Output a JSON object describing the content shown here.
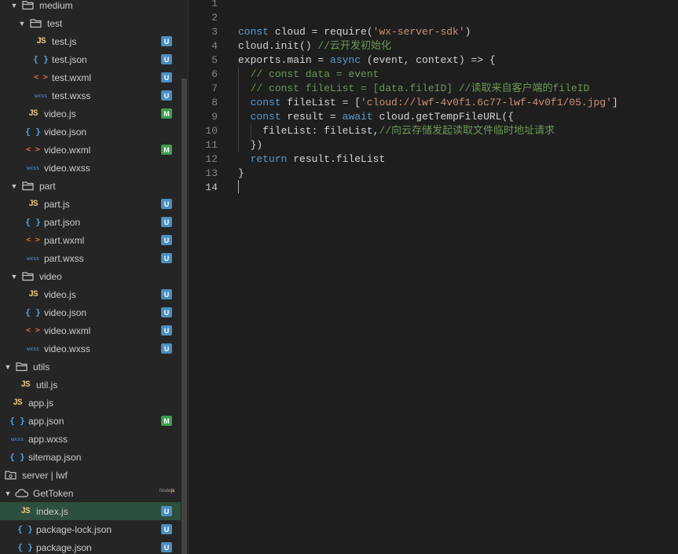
{
  "explorer": {
    "rows": [
      {
        "label": "medium",
        "type": "folder",
        "badge": "",
        "depth": 1
      },
      {
        "label": "test",
        "type": "folder",
        "badge": "",
        "depth": 2
      },
      {
        "label": "test.js",
        "type": "js",
        "badge": "U",
        "depth": 4
      },
      {
        "label": "test.json",
        "type": "json",
        "badge": "U",
        "depth": 4
      },
      {
        "label": "test.wxml",
        "type": "wxml",
        "badge": "U",
        "depth": 4
      },
      {
        "label": "test.wxss",
        "type": "wxss",
        "badge": "U",
        "depth": 4
      },
      {
        "label": "video.js",
        "type": "js",
        "badge": "M",
        "depth": 3
      },
      {
        "label": "video.json",
        "type": "json",
        "badge": "",
        "depth": 3
      },
      {
        "label": "video.wxml",
        "type": "wxml",
        "badge": "M",
        "depth": 3
      },
      {
        "label": "video.wxss",
        "type": "wxss",
        "badge": "",
        "depth": 3
      },
      {
        "label": "part",
        "type": "folder",
        "badge": "",
        "depth": 1
      },
      {
        "label": "part.js",
        "type": "js",
        "badge": "U",
        "depth": 3
      },
      {
        "label": "part.json",
        "type": "json",
        "badge": "U",
        "depth": 3
      },
      {
        "label": "part.wxml",
        "type": "wxml",
        "badge": "U",
        "depth": 3
      },
      {
        "label": "part.wxss",
        "type": "wxss",
        "badge": "U",
        "depth": 3
      },
      {
        "label": "video",
        "type": "folder",
        "badge": "",
        "depth": 1
      },
      {
        "label": "video.js",
        "type": "js",
        "badge": "U",
        "depth": 3
      },
      {
        "label": "video.json",
        "type": "json",
        "badge": "U",
        "depth": 3
      },
      {
        "label": "video.wxml",
        "type": "wxml",
        "badge": "U",
        "depth": 3
      },
      {
        "label": "video.wxss",
        "type": "wxss",
        "badge": "U",
        "depth": 3
      },
      {
        "label": "utils",
        "type": "folder",
        "badge": "",
        "depth": 0
      },
      {
        "label": "util.js",
        "type": "js",
        "badge": "",
        "depth": 2
      },
      {
        "label": "app.js",
        "type": "js",
        "badge": "",
        "depth": 1
      },
      {
        "label": "app.json",
        "type": "json",
        "badge": "M",
        "depth": 1
      },
      {
        "label": "app.wxss",
        "type": "wxss",
        "badge": "",
        "depth": 1
      },
      {
        "label": "sitemap.json",
        "type": "json",
        "badge": "",
        "depth": 1
      },
      {
        "label": "server | lwf",
        "type": "server",
        "badge": "",
        "depth": 0
      },
      {
        "label": "GetToken",
        "type": "cloudfn",
        "badge": "",
        "depth": 0
      },
      {
        "label": "index.js",
        "type": "js",
        "badge": "U",
        "depth": 2,
        "selected": true
      },
      {
        "label": "package-lock.json",
        "type": "json",
        "badge": "U",
        "depth": 2
      },
      {
        "label": "package.json",
        "type": "json",
        "badge": "U",
        "depth": 2
      }
    ],
    "runtime_badge_prefix": "Node",
    "runtime_badge_suffix": "js"
  },
  "icons": {
    "js": "JS",
    "json": "{ }",
    "wxml": "< >",
    "wxss": "wxss"
  },
  "editor": {
    "cursor_line": 14,
    "lines": [
      [],
      [],
      [
        {
          "t": "kw",
          "v": "const"
        },
        {
          "t": "",
          "v": " cloud = require("
        },
        {
          "t": "str",
          "v": "'wx-server-sdk'"
        },
        {
          "t": "",
          "v": ")"
        }
      ],
      [
        {
          "t": "",
          "v": "cloud.init() "
        },
        {
          "t": "cm",
          "v": "//云开发初始化"
        }
      ],
      [
        {
          "t": "",
          "v": "exports.main = "
        },
        {
          "t": "kw",
          "v": "async"
        },
        {
          "t": "",
          "v": " (event, context) => {"
        }
      ],
      [
        {
          "t": "",
          "v": "  "
        },
        {
          "t": "cm",
          "v": "// const data = event"
        }
      ],
      [
        {
          "t": "",
          "v": "  "
        },
        {
          "t": "cm",
          "v": "// const fileList = [data.fileID] //读取来自客户端的fileID"
        }
      ],
      [
        {
          "t": "",
          "v": "  "
        },
        {
          "t": "kw",
          "v": "const"
        },
        {
          "t": "",
          "v": " fileList = ["
        },
        {
          "t": "str",
          "v": "'cloud://lwf-4v0f1.6c77-lwf-4v0f1/05.jpg'"
        },
        {
          "t": "",
          "v": "]"
        }
      ],
      [
        {
          "t": "",
          "v": "  "
        },
        {
          "t": "kw",
          "v": "const"
        },
        {
          "t": "",
          "v": " result = "
        },
        {
          "t": "kw",
          "v": "await"
        },
        {
          "t": "",
          "v": " cloud.getTempFileURL({"
        }
      ],
      [
        {
          "t": "",
          "v": "    fileList: fileList,"
        },
        {
          "t": "cm",
          "v": "//向云存储发起读取文件临时地址请求"
        }
      ],
      [
        {
          "t": "",
          "v": "  })"
        }
      ],
      [
        {
          "t": "",
          "v": "  "
        },
        {
          "t": "kw",
          "v": "return"
        },
        {
          "t": "",
          "v": " result.fileList"
        }
      ],
      [
        {
          "t": "",
          "v": "}"
        }
      ],
      []
    ]
  },
  "colors": {
    "badge_U": "#4b8fbf",
    "badge_M": "#3d9c4f",
    "selected_row": "#2c4f3e"
  }
}
